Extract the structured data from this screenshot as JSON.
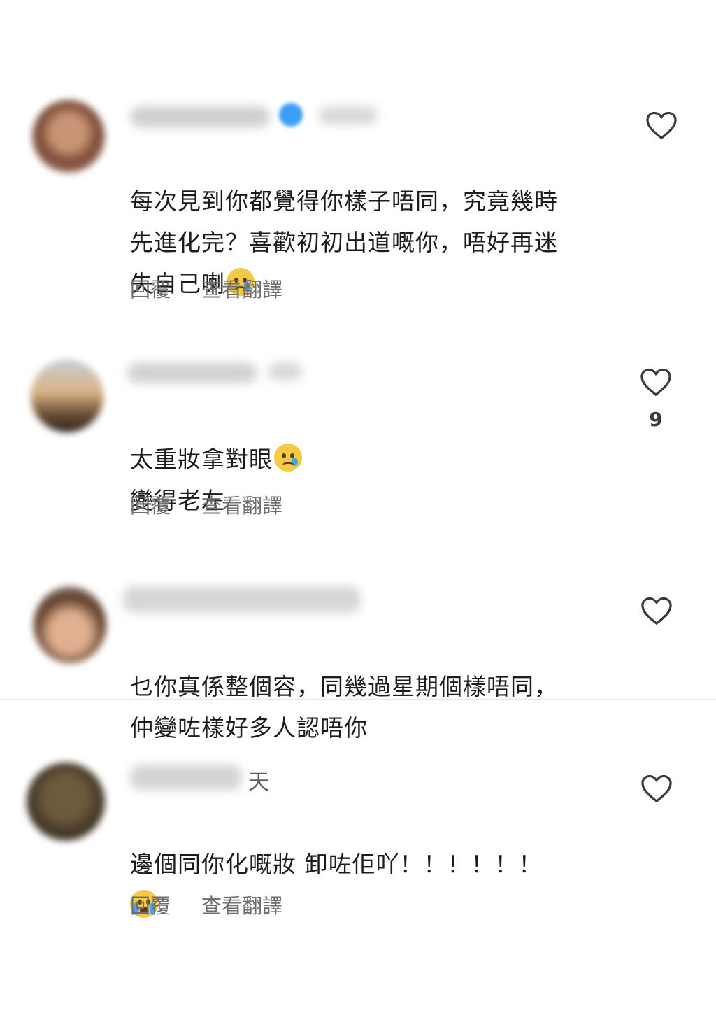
{
  "comments": [
    {
      "text": "每次見到你都覺得你樣子唔同，究竟幾時\n先進化完？喜歡初初出道嘅你，唔好再迷\n失自己喇",
      "reply": "回覆",
      "translate": "查看翻譯"
    },
    {
      "text": "太重妝拿對眼",
      "text2": "變得老左",
      "likes": "9",
      "reply": "回覆",
      "translate": "查看翻譯"
    },
    {
      "text": "乜你真係整個容，同幾過星期個樣唔同，\n仲變咗樣好多人認唔你"
    },
    {
      "day": "天",
      "text": "邊個同你化嘅妝 卸咗佢吖！！！！！！",
      "reply": "回覆",
      "translate": "查看翻譯"
    }
  ],
  "icons": {
    "like": "heart-outline-icon",
    "sad": "crying-face-icon",
    "sob": "loudly-crying-face-icon"
  },
  "colors": {
    "verified": "#3d9df5",
    "heart_stroke": "#3a3a3a"
  }
}
